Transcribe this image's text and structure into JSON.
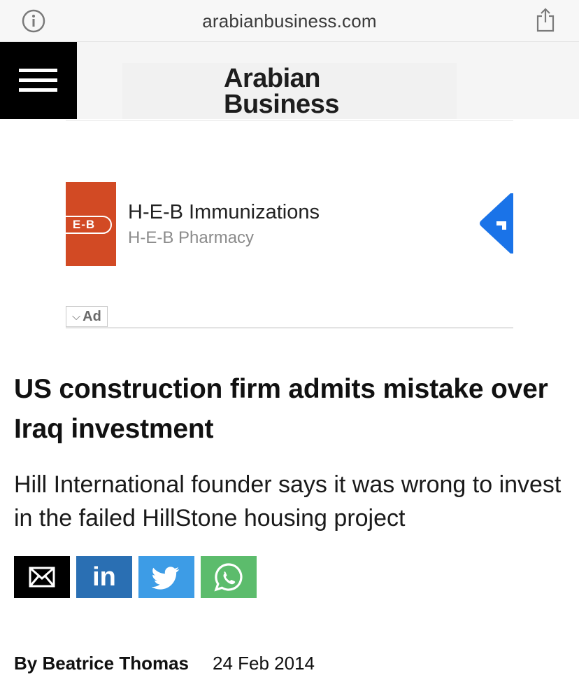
{
  "browser": {
    "url": "arabianbusiness.com"
  },
  "site": {
    "logo_line1": "Arabian",
    "logo_line2": "Business"
  },
  "ad": {
    "brand_mark": "E-B",
    "title": "H-E-B Immunizations",
    "subtitle": "H-E-B Pharmacy",
    "label": "Ad",
    "brand_color": "#d24a24",
    "arrow_color": "#1a73e8"
  },
  "article": {
    "headline": "US construction firm admits mistake over Iraq investment",
    "subheadline": "Hill International founder says it was wrong to invest in the failed HillStone housing project",
    "byline_prefix": "By",
    "author": "Beatrice Thomas",
    "date": "24 Feb 2014"
  },
  "share": {
    "buttons": [
      {
        "name": "email",
        "icon": "envelope-icon",
        "color": "#000000"
      },
      {
        "name": "linkedin",
        "icon": "linkedin-icon",
        "label": "in",
        "color": "#2a6fb3"
      },
      {
        "name": "twitter",
        "icon": "twitter-bird-icon",
        "color": "#3d9ce6"
      },
      {
        "name": "whatsapp",
        "icon": "whatsapp-icon",
        "color": "#5cbc6c"
      }
    ]
  }
}
